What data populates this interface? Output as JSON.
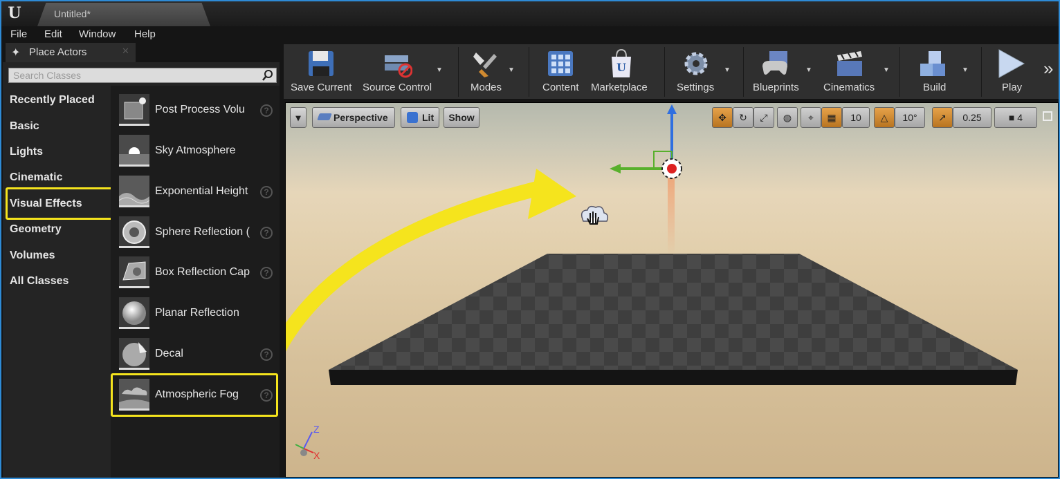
{
  "window": {
    "tab_title": "Untitled*"
  },
  "menu": [
    "File",
    "Edit",
    "Window",
    "Help"
  ],
  "place_actors": {
    "tab_label": "Place Actors",
    "search_placeholder": "Search Classes",
    "categories": [
      "Recently Placed",
      "Basic",
      "Lights",
      "Cinematic",
      "Visual Effects",
      "Geometry",
      "Volumes",
      "All Classes"
    ],
    "selected_category": "Visual Effects",
    "items": [
      {
        "label": "Post Process Volu",
        "thumb": "post-process-volume-icon",
        "help": true
      },
      {
        "label": "Sky Atmosphere",
        "thumb": "sky-atmosphere-icon",
        "help": false
      },
      {
        "label": "Exponential Height",
        "thumb": "exponential-height-fog-icon",
        "help": true
      },
      {
        "label": "Sphere Reflection (",
        "thumb": "sphere-reflection-capture-icon",
        "help": true
      },
      {
        "label": "Box Reflection Cap",
        "thumb": "box-reflection-capture-icon",
        "help": true
      },
      {
        "label": "Planar Reflection",
        "thumb": "planar-reflection-icon",
        "help": false
      },
      {
        "label": "Decal",
        "thumb": "decal-icon",
        "help": true
      },
      {
        "label": "Atmospheric Fog",
        "thumb": "atmospheric-fog-icon",
        "help": true
      }
    ],
    "highlighted_item": "Atmospheric Fog"
  },
  "toolbar": {
    "save": "Save Current",
    "source_control": "Source Control",
    "modes": "Modes",
    "content": "Content",
    "marketplace": "Marketplace",
    "settings": "Settings",
    "blueprints": "Blueprints",
    "cinematics": "Cinematics",
    "build": "Build",
    "play": "Play",
    "more": "»"
  },
  "viewport": {
    "perspective": "Perspective",
    "lit": "Lit",
    "show": "Show",
    "grid_snap": "10",
    "rotation_snap": "10°",
    "scale_snap": "0.25",
    "camera_speed": "4",
    "axis": {
      "z": "Z",
      "x": "X"
    }
  },
  "colors": {
    "highlight": "#f5e41d",
    "accent": "#2e8bd6",
    "active_tool": "#d08a30"
  }
}
